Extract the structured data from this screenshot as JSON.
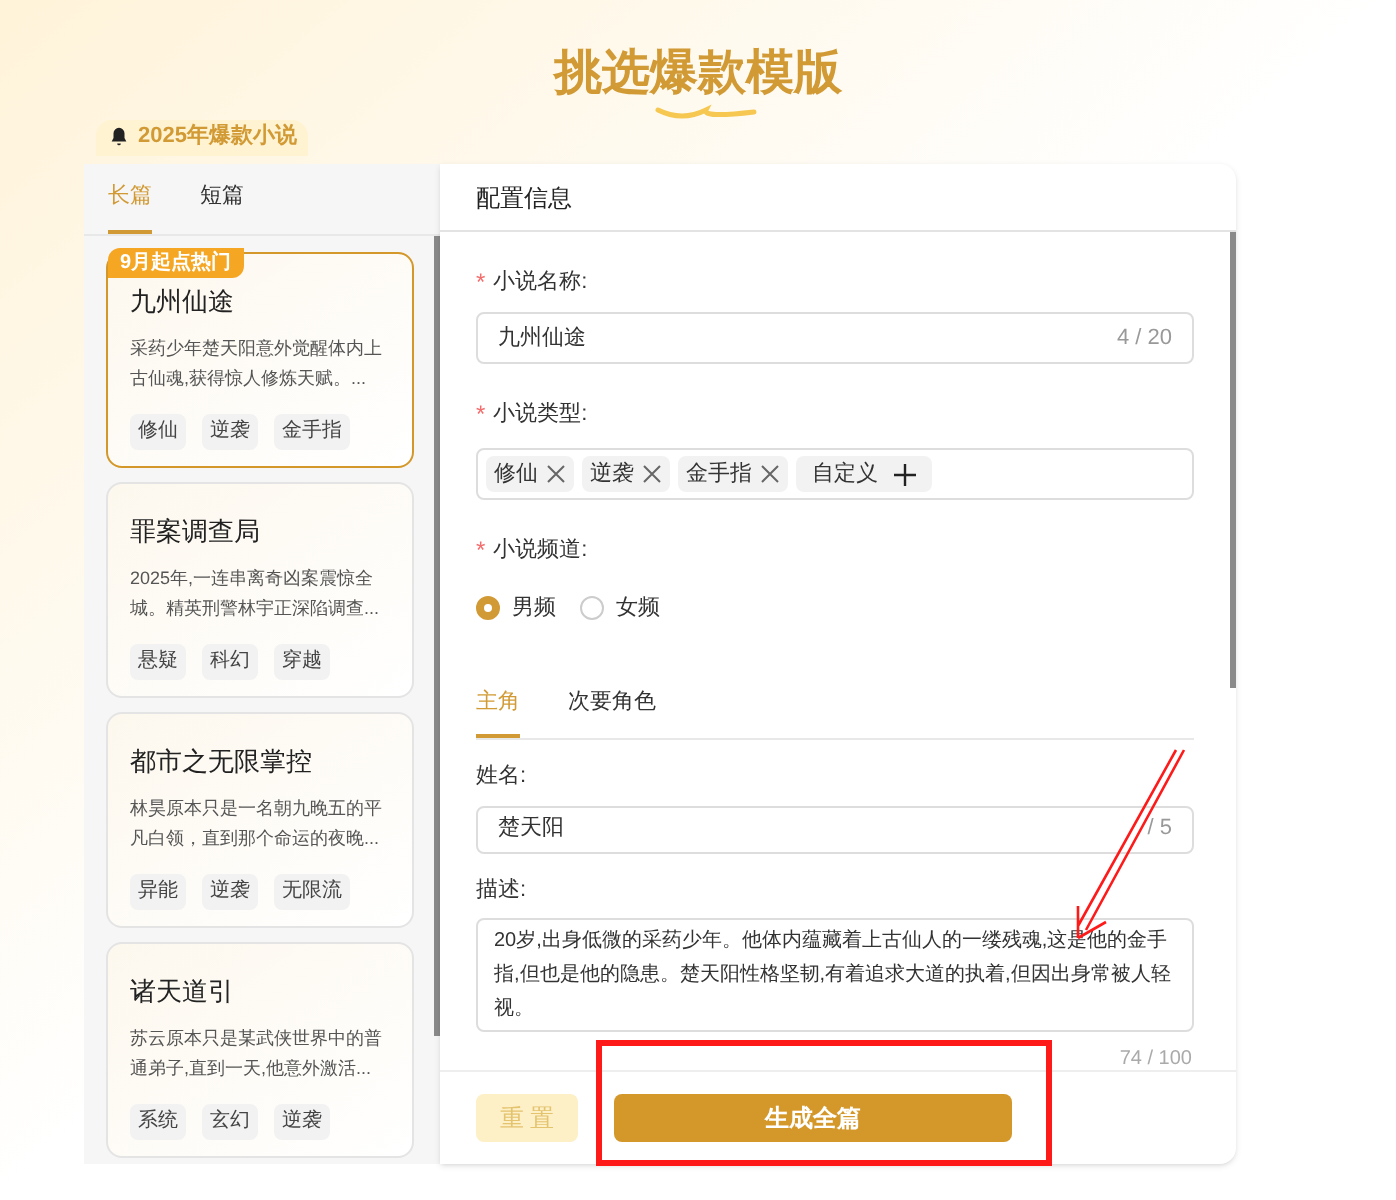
{
  "title": "挑选爆款模版",
  "badge": "2025年爆款小说",
  "sidebar": {
    "tabs": [
      {
        "label": "长篇",
        "selected": true
      },
      {
        "label": "短篇",
        "selected": false
      }
    ],
    "cards": [
      {
        "title": "九州仙途",
        "desc": "采药少年楚天阳意外觉醒体内上古仙魂,获得惊人修炼天赋。...",
        "tags": [
          "修仙",
          "逆袭",
          "金手指"
        ],
        "selected": true,
        "ribbon": "9月起点热门"
      },
      {
        "title": "罪案调查局",
        "desc": "2025年,一连串离奇凶案震惊全城。精英刑警林宇正深陷调查...",
        "tags": [
          "悬疑",
          "科幻",
          "穿越"
        ],
        "selected": false
      },
      {
        "title": "都市之无限掌控",
        "desc": "林昊原本只是一名朝九晚五的平凡白领，直到那个命运的夜晚...",
        "tags": [
          "异能",
          "逆袭",
          "无限流"
        ],
        "selected": false
      },
      {
        "title": "诸天道引",
        "desc": "苏云原本只是某武侠世界中的普通弟子,直到一天,他意外激活...",
        "tags": [
          "系统",
          "玄幻",
          "逆袭"
        ],
        "selected": false
      }
    ]
  },
  "config": {
    "header": "配置信息",
    "name_label": "小说名称:",
    "name_value": "九州仙途",
    "name_count": "4 / 20",
    "required_mark": "*",
    "type_label": "小说类型:",
    "types": [
      "修仙",
      "逆袭",
      "金手指"
    ],
    "custom": "自定义",
    "channel_label": "小说频道:",
    "channels": [
      {
        "label": "男频",
        "selected": true
      },
      {
        "label": "女频",
        "selected": false
      }
    ],
    "role_tabs": [
      {
        "label": "主角",
        "selected": true
      },
      {
        "label": "次要角色",
        "selected": false
      }
    ],
    "role_name_label": "姓名:",
    "role_name_value": "楚天阳",
    "role_name_count": "/ 5",
    "desc_label": "描述:",
    "desc_value": "20岁,出身低微的采药少年。他体内蕴藏着上古仙人的一缕残魂,这是他的金手指,但也是他的隐患。楚天阳性格坚韧,有着追求大道的执着,但因出身常被人轻视。",
    "desc_count": "74 / 100",
    "reset": "重 置",
    "generate": "生成全篇"
  }
}
